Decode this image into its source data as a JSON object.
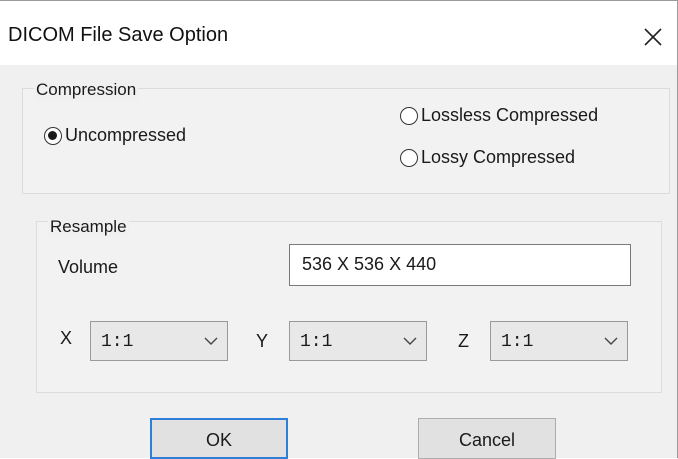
{
  "dialog": {
    "title": "DICOM File Save Option",
    "close_icon": "close-icon"
  },
  "compression": {
    "label": "Compression",
    "options": [
      {
        "label": "Uncompressed",
        "selected": true
      },
      {
        "label": "Lossless Compressed",
        "selected": false
      },
      {
        "label": "Lossy Compressed",
        "selected": false
      }
    ]
  },
  "resample": {
    "label": "Resample",
    "volume_label": "Volume",
    "volume_value": "536 X 536 X 440",
    "axes": [
      {
        "label": "X",
        "value": "1:1"
      },
      {
        "label": "Y",
        "value": "1:1"
      },
      {
        "label": "Z",
        "value": "1:1"
      }
    ],
    "dropdown_icon": "chevron-down-icon"
  },
  "buttons": {
    "ok": "OK",
    "cancel": "Cancel"
  },
  "colors": {
    "dialog_bg": "#f0f0f0",
    "titlebar_bg": "#ffffff",
    "default_button_border": "#2f7fd8"
  }
}
